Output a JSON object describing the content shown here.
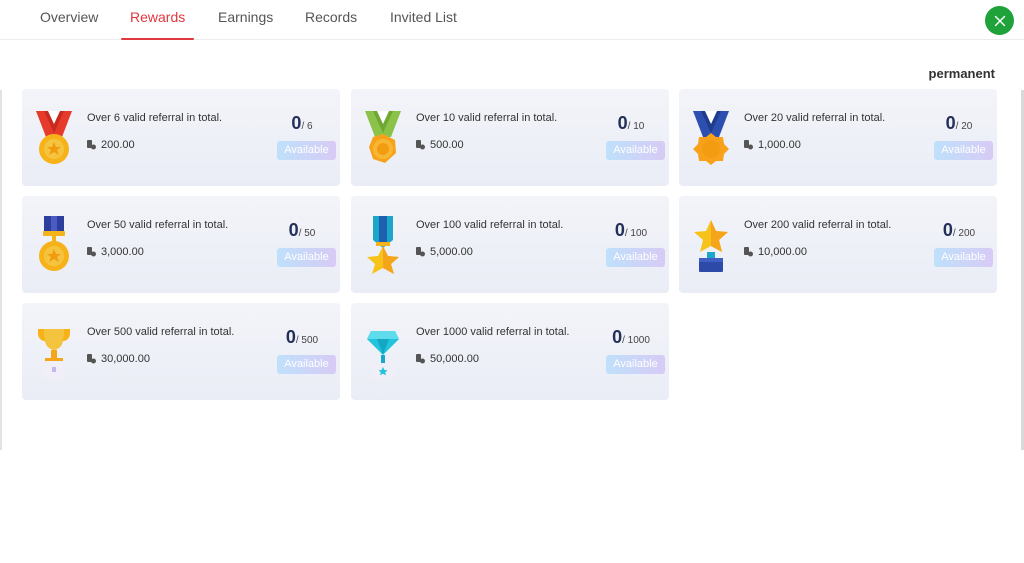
{
  "tabs": [
    {
      "label": "Overview",
      "active": false
    },
    {
      "label": "Rewards",
      "active": true
    },
    {
      "label": "Earnings",
      "active": false
    },
    {
      "label": "Records",
      "active": false
    },
    {
      "label": "Invited List",
      "active": false
    }
  ],
  "period_label": "permanent",
  "colors": {
    "accent": "#e0383e",
    "close_button": "#1fa23a",
    "progress_value": "#23305a"
  },
  "rewards": [
    {
      "title": "Over 6 valid referral in total.",
      "amount": "200.00",
      "current": "0",
      "total": "/ 6",
      "status": "Available",
      "icon": "red-ribbon-medal-icon"
    },
    {
      "title": "Over 10 valid referral in total.",
      "amount": "500.00",
      "current": "0",
      "total": "/ 10",
      "status": "Available",
      "icon": "green-ribbon-medal-icon"
    },
    {
      "title": "Over 20 valid referral in total.",
      "amount": "1,000.00",
      "current": "0",
      "total": "/ 20",
      "status": "Available",
      "icon": "blue-ribbon-medal-icon"
    },
    {
      "title": "Over 50 valid referral in total.",
      "amount": "3,000.00",
      "current": "0",
      "total": "/ 50",
      "status": "Available",
      "icon": "navy-strap-medal-icon"
    },
    {
      "title": "Over 100 valid referral in total.",
      "amount": "5,000.00",
      "current": "0",
      "total": "/ 100",
      "status": "Available",
      "icon": "star-medal-icon"
    },
    {
      "title": "Over 200 valid referral in total.",
      "amount": "10,000.00",
      "current": "0",
      "total": "/ 200",
      "status": "Available",
      "icon": "star-trophy-icon"
    },
    {
      "title": "Over 500 valid referral in total.",
      "amount": "30,000.00",
      "current": "0",
      "total": "/ 500",
      "status": "Available",
      "icon": "gold-cup-trophy-icon"
    },
    {
      "title": "Over 1000 valid referral in total.",
      "amount": "50,000.00",
      "current": "0",
      "total": "/ 1000",
      "status": "Available",
      "icon": "diamond-trophy-icon"
    }
  ]
}
